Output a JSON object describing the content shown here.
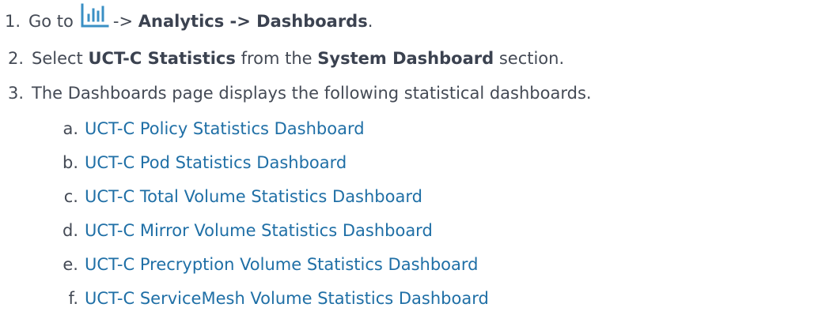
{
  "steps": [
    {
      "num": "1.",
      "pre": "Go to",
      "icon": "analytics-bar-chart-icon",
      "arrow": "->",
      "bold1": "Analytics -> Dashboards",
      "post": "."
    },
    {
      "num": "2.",
      "pre": "Select",
      "bold1": "UCT-C Statistics",
      "mid": "from the",
      "bold2": "System Dashboard",
      "post": "section."
    },
    {
      "num": "3.",
      "text": "The Dashboards page displays the following statistical dashboards."
    }
  ],
  "dashboards": [
    {
      "letter": "a.",
      "label": "UCT-C Policy Statistics Dashboard"
    },
    {
      "letter": "b.",
      "label": "UCT-C Pod Statistics Dashboard"
    },
    {
      "letter": "c.",
      "label": "UCT-C Total Volume Statistics Dashboard"
    },
    {
      "letter": "d.",
      "label": "UCT-C Mirror Volume Statistics Dashboard"
    },
    {
      "letter": "e.",
      "label": "UCT-C Precryption Volume Statistics Dashboard"
    },
    {
      "letter": "f.",
      "label": "UCT-C ServiceMesh Volume Statistics Dashboard"
    }
  ],
  "colors": {
    "text": "#444a55",
    "link": "#1f6fa6",
    "icon": "#3a8fc4"
  }
}
